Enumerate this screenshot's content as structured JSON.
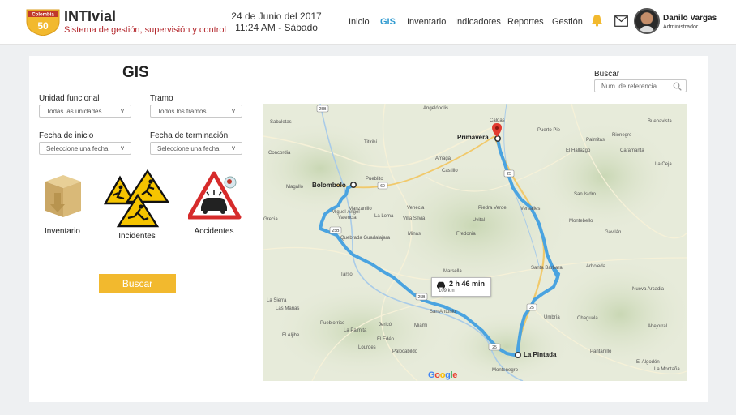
{
  "header": {
    "badge_country": "Colombia",
    "badge_number": "50",
    "brand_name": "INTIvial",
    "brand_subtitle": "Sistema de gestión, supervisión y control",
    "date": "24 de Junio del 2017",
    "time": "11:24 AM - Sábado",
    "nav": [
      "Inicio",
      "GIS",
      "Inventario",
      "Indicadores",
      "Reportes",
      "Gestión"
    ],
    "active_nav": "GIS",
    "user_name": "Danilo Vargas",
    "user_role": "Administrador"
  },
  "filters": {
    "title": "GIS",
    "unidad_label": "Unidad funcional",
    "unidad_value": "Todas las unidades",
    "tramo_label": "Tramo",
    "tramo_value": "Todos los tramos",
    "inicio_label": "Fecha de inicio",
    "inicio_placeholder": "Seleccione una fecha",
    "fin_label": "Fecha de terminación",
    "fin_placeholder": "Seleccione una fecha",
    "search_label": "Buscar",
    "search_placeholder": "Num. de referencia"
  },
  "categories": [
    {
      "label": "Inventario",
      "icon": "box-icon"
    },
    {
      "label": "Incidentes",
      "icon": "incident-warning-icon"
    },
    {
      "label": "Accidentes",
      "icon": "car-accident-icon"
    }
  ],
  "buscar_button": "Buscar",
  "map": {
    "origin": "Primavera",
    "waypoint": "Bolombolo",
    "destination": "La Pintada",
    "route_time": "2 h 46 min",
    "route_distance": "109 km",
    "road_labels": [
      "25B",
      "60",
      "25",
      "25",
      "25B",
      "25B",
      "25"
    ],
    "places": [
      "Angelópolis",
      "Caldas",
      "Buenavista",
      "Concordia",
      "Titiribí",
      "Amagá",
      "El Hallazgo",
      "La Ceja",
      "Palmitas",
      "Caramanta",
      "Puerto Pie",
      "Rionegro",
      "Manzanillo",
      "Venecia",
      "La Loma",
      "Villa Silvia",
      "Uvital",
      "Piedra Verde",
      "Versalles",
      "San Isidro",
      "Magallo",
      "Miguel Ángel",
      "Valencia",
      "Minas",
      "Fredonia",
      "Montebello",
      "Gavilán",
      "Grecia",
      "Quebrada Guadalajara",
      "Marsella",
      "Santa Bárbara",
      "Arboleda",
      "Tarso",
      "La Sierra",
      "Las Marias",
      "San Antonio",
      "Umbría",
      "Chaguala",
      "Abejorral",
      "Pueblorrico",
      "Jericó",
      "Miami",
      "La Palmita",
      "El Aljibe",
      "El Edén",
      "Lourdes",
      "Palocabildo",
      "Pantanillo",
      "El Algodón",
      "Montenegro",
      "La Montaña",
      "Castillo",
      "Sabaletas",
      "Pueblito",
      "Nueva Arcadia"
    ],
    "google": "Google"
  },
  "colors": {
    "accent": "#2f9ad0",
    "brand_red": "#b3262b",
    "button": "#f2b92e",
    "route": "#4aa3e0"
  }
}
